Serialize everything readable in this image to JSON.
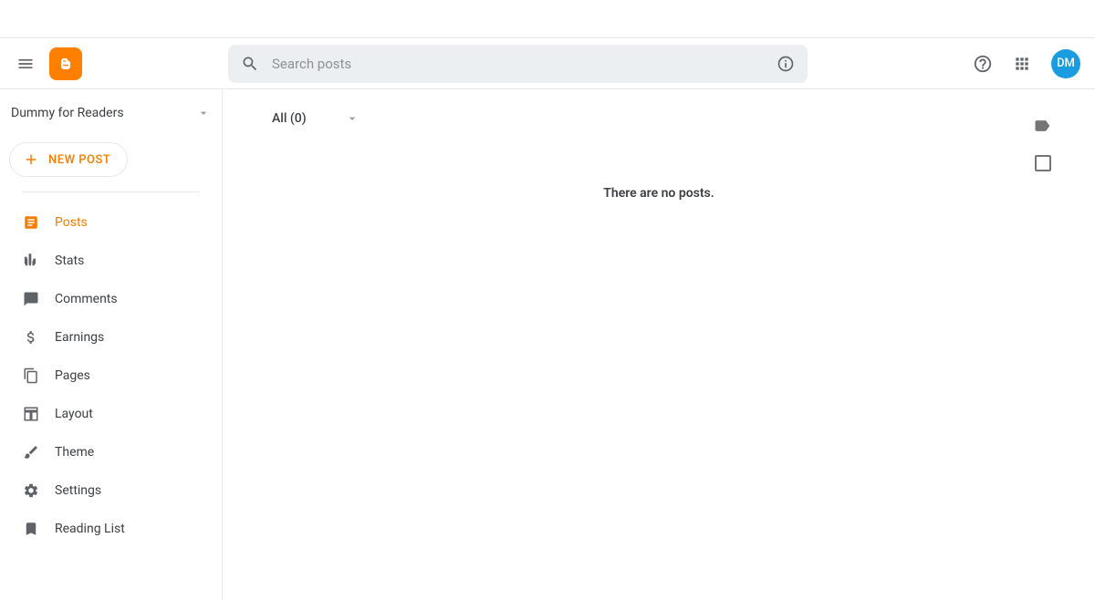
{
  "header": {
    "search_placeholder": "Search posts",
    "avatar_initials": "DM"
  },
  "sidebar": {
    "blog_name": "Dummy for Readers",
    "new_post_label": "NEW POST",
    "items": [
      {
        "icon": "posts",
        "label": "Posts",
        "active": true
      },
      {
        "icon": "stats",
        "label": "Stats",
        "active": false
      },
      {
        "icon": "comments",
        "label": "Comments",
        "active": false
      },
      {
        "icon": "earnings",
        "label": "Earnings",
        "active": false
      },
      {
        "icon": "pages",
        "label": "Pages",
        "active": false
      },
      {
        "icon": "layout",
        "label": "Layout",
        "active": false
      },
      {
        "icon": "theme",
        "label": "Theme",
        "active": false
      },
      {
        "icon": "settings",
        "label": "Settings",
        "active": false
      },
      {
        "icon": "reading-list",
        "label": "Reading List",
        "active": false
      }
    ]
  },
  "main": {
    "filter_label": "All (0)",
    "empty_message": "There are no posts."
  },
  "colors": {
    "accent": "#f57c00",
    "logo": "#ff8000",
    "avatar": "#1a9de0"
  }
}
